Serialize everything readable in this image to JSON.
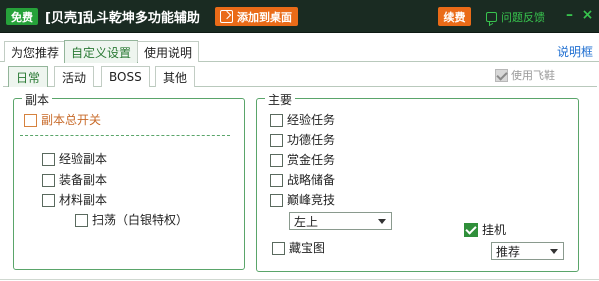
{
  "titlebar": {
    "free_badge": "免费",
    "title": "[贝壳]乱斗乾坤多功能辅助",
    "add_desktop": "添加到桌面",
    "renew": "续费",
    "feedback": "问题反馈",
    "minimize": "–",
    "close": "×"
  },
  "main_tabs": [
    "为您推荐",
    "自定义设置",
    "使用说明"
  ],
  "help_link": "说明框",
  "sub_tabs": [
    "日常",
    "活动",
    "BOSS",
    "其他"
  ],
  "use_flyshoe": {
    "label": "使用飞鞋",
    "checked": true,
    "disabled": true
  },
  "dungeon": {
    "title": "副本",
    "master_switch": "副本总开关",
    "items": [
      "经验副本",
      "装备副本",
      "材料副本"
    ],
    "sweep": "扫荡（白银特权）"
  },
  "main": {
    "title": "主要",
    "items": [
      "经验任务",
      "功德任务",
      "赏金任务",
      "战略储备",
      "巅峰竞技"
    ],
    "peak_option": "左上",
    "treasure_map": "藏宝图",
    "hangup": {
      "label": "挂机",
      "checked": true
    },
    "hangup_option": "推荐"
  },
  "colors": {
    "titlebar_bg": "#1a2b22",
    "accent_green": "#26a23a",
    "accent_orange": "#ea6b18",
    "link_blue": "#1f6fd1"
  }
}
